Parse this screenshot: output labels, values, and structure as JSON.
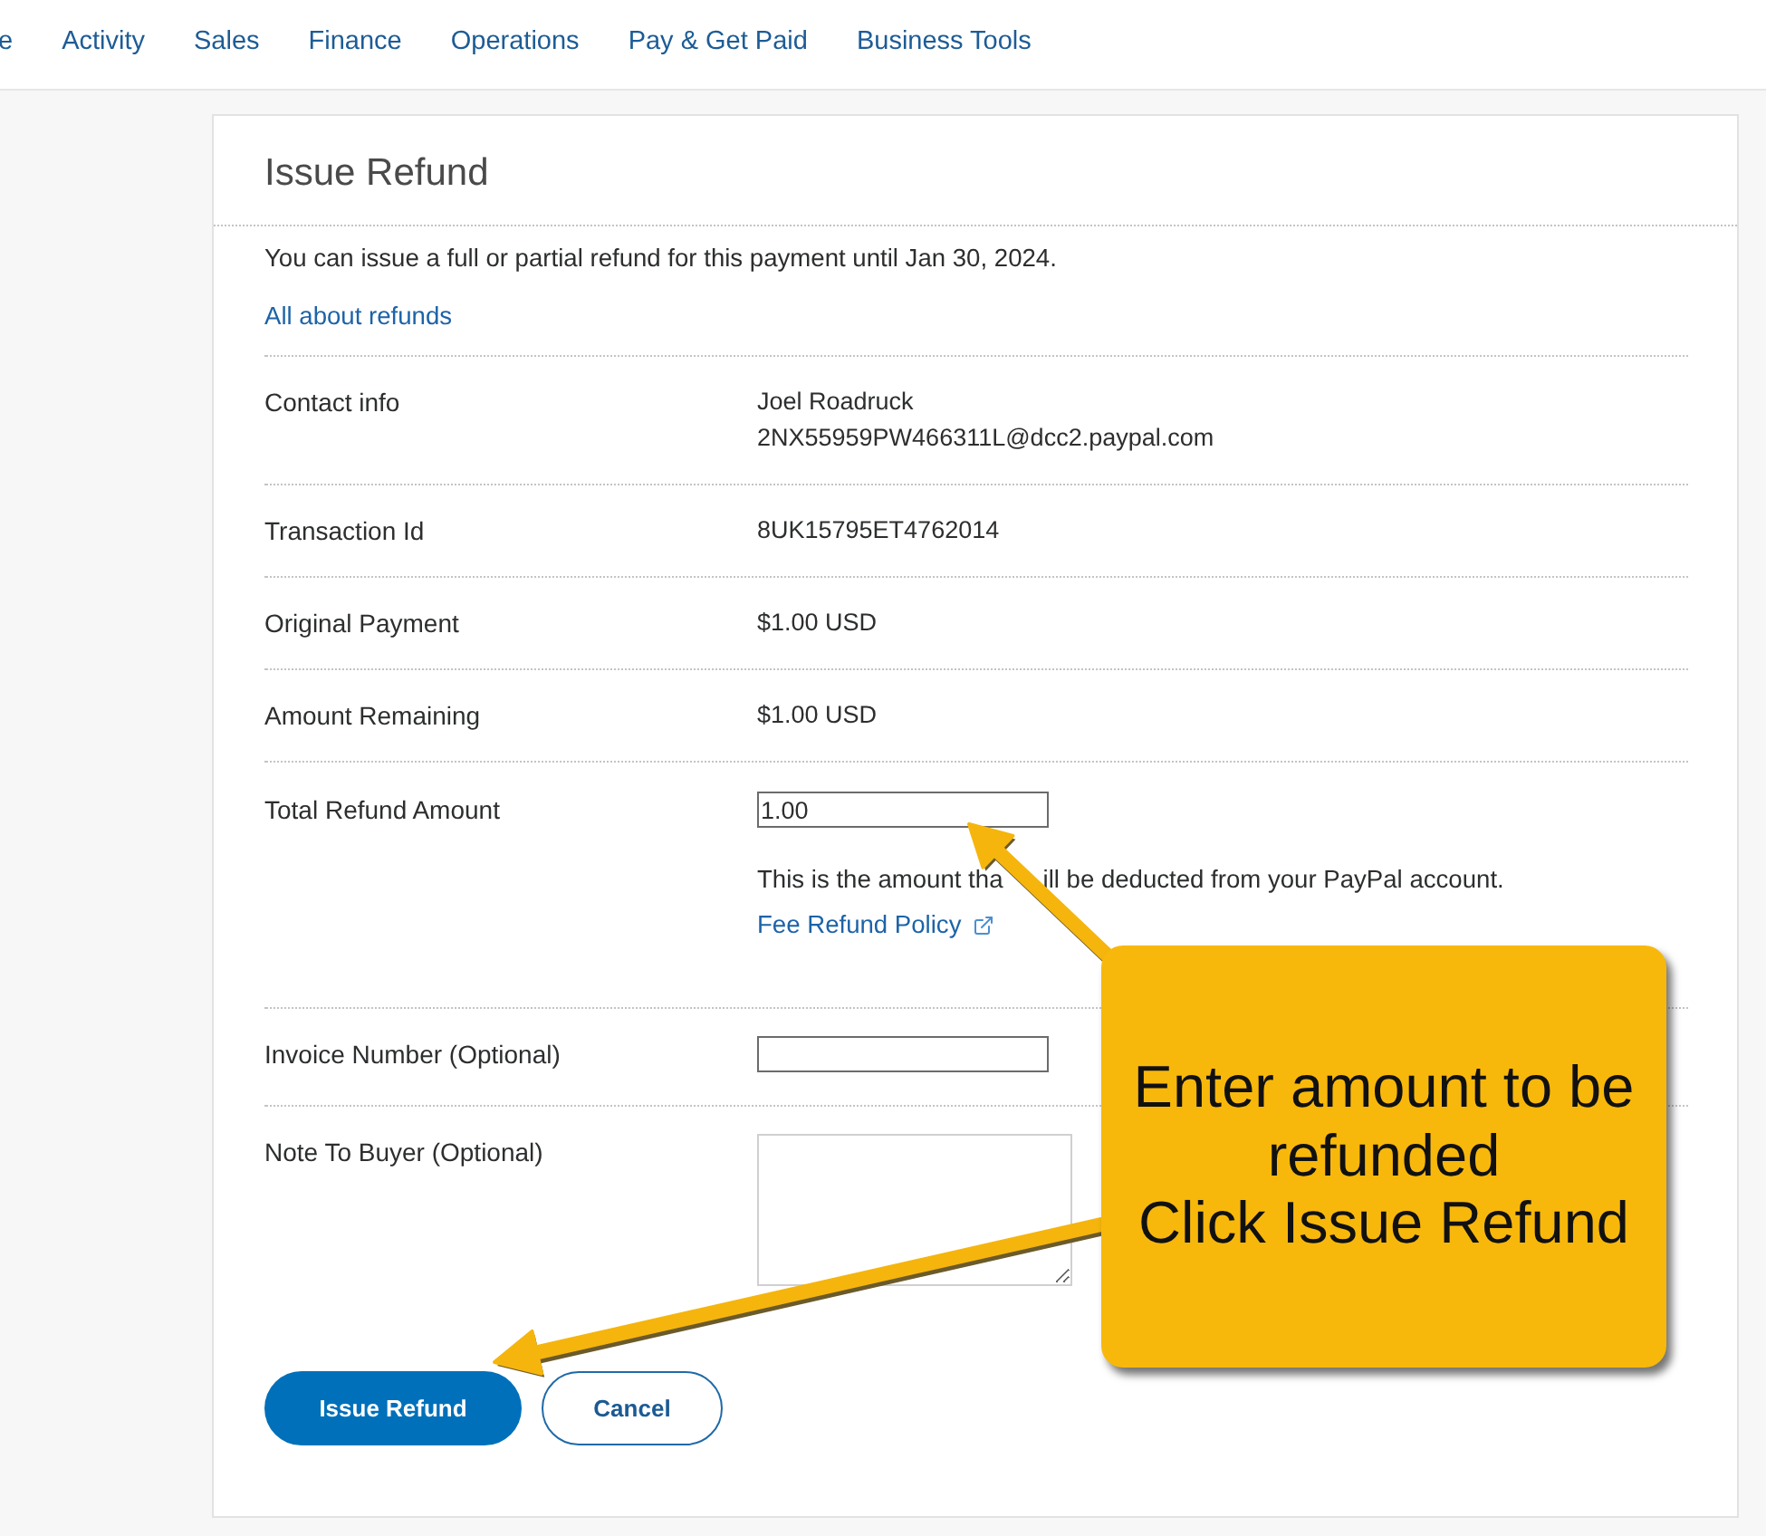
{
  "nav": {
    "items": [
      "e",
      "Activity",
      "Sales",
      "Finance",
      "Operations",
      "Pay & Get Paid",
      "Business Tools"
    ]
  },
  "panel": {
    "title": "Issue Refund",
    "notice": "You can issue a full or partial refund for this payment until Jan 30, 2024.",
    "link": "All about refunds"
  },
  "details": [
    {
      "kind": "text",
      "label": "Contact info",
      "lines": [
        "Joel Roadruck",
        "2NX55959PW466311L@dcc2.paypal.com"
      ]
    },
    {
      "kind": "text",
      "label": "Transaction Id",
      "lines": [
        "8UK15795ET4762014"
      ]
    },
    {
      "kind": "text",
      "label": "Original Payment",
      "lines": [
        "$1.00 USD"
      ]
    },
    {
      "kind": "text",
      "label": "Amount Remaining",
      "lines": [
        "$1.00 USD"
      ]
    },
    {
      "kind": "input",
      "label": "Total Refund Amount",
      "value": "1.00",
      "help": [
        "This is the amount tha",
        "ill be deducted from your PayPal account."
      ],
      "link": "Fee Refund Policy"
    },
    {
      "kind": "input",
      "label": "Invoice Number (Optional)"
    },
    {
      "kind": "textarea",
      "label": "Note To Buyer (Optional)"
    }
  ],
  "buttons": [
    {
      "kind": "primary",
      "label": "Issue Refund"
    },
    {
      "kind": "secondary",
      "label": "Cancel"
    }
  ],
  "callout": {
    "lines": [
      "Enter amount to be refunded",
      "Click Issue Refund"
    ]
  }
}
